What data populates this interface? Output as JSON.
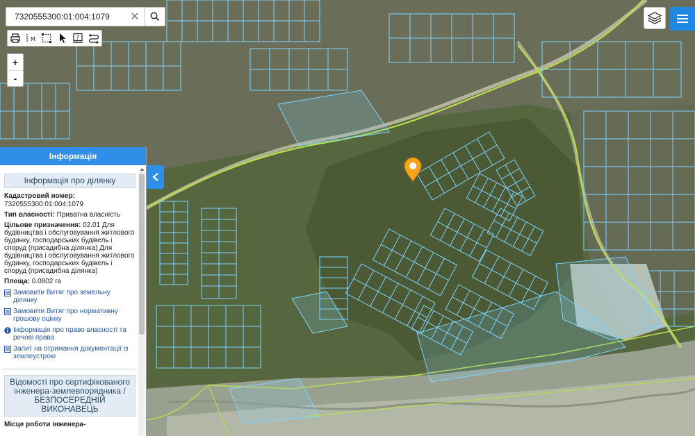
{
  "search": {
    "value": "7320555300:01:004:1079",
    "clear_icon": "close-icon",
    "search_icon": "search-icon"
  },
  "toolbar": {
    "tools": [
      "print-icon",
      "measure-icon",
      "select-area-icon",
      "pointer-icon",
      "identify-icon",
      "route-icon"
    ]
  },
  "zoom": {
    "in": "+",
    "out": "-"
  },
  "panel": {
    "header": "Інформація",
    "section_title": "Інформація про ділянку",
    "cadastral_label": "Кадастровий номер:",
    "cadastral_value": "7320555300:01:004:1079",
    "ownership_label": "Тип власності:",
    "ownership_value": "Приватна власність",
    "purpose_label": "Цільове призначення:",
    "purpose_value": "02.01 Для будівництва і обслуговування житлового будинку, господарських будівель і споруд (присадибна ділянка) Для будівництва і обслуговування житлового будинку, господарських будівель і споруд (присадибна ділянка)",
    "area_label": "Площа:",
    "area_value": "0.0802 га",
    "links": [
      {
        "icon": "document-icon",
        "text": "Замовити Витяг про земельну ділянку"
      },
      {
        "icon": "document-icon",
        "text": "Замовити Витяг про нормативну грошову оцінку"
      },
      {
        "icon": "info-icon",
        "text": "Інформація про право власності та речові права"
      },
      {
        "icon": "document-icon",
        "text": "Запит на отримання документації із землеустрою"
      }
    ],
    "engineer_title": "Відомості про сертифікованого інженера-землевпорядника / БЕЗПОСЕРЕДНІЙ ВИКОНАВЕЦЬ",
    "engineer_place": "Місце роботи інженера-"
  },
  "colors": {
    "accent": "#2f8ee8",
    "parcel": "#7fd3ff",
    "road": "#b6dd4a",
    "pin": "#f6a51a"
  }
}
